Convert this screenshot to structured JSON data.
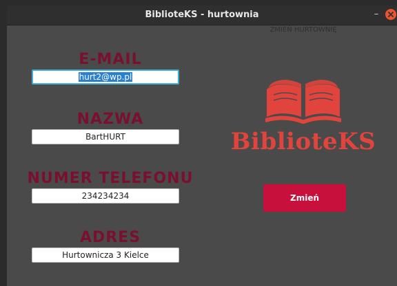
{
  "window": {
    "title": "BiblioteKS - hurtownia",
    "minimize_glyph": "–"
  },
  "form": {
    "email": {
      "label": "E-MAIL",
      "value": "hurt2@wp.pl"
    },
    "name": {
      "label": "NAZWA",
      "value": "BartHURT"
    },
    "phone": {
      "label": "NUMER TELEFONU",
      "value": "234234234"
    },
    "address": {
      "label": "ADRES",
      "value": "Hurtownicza 3 Kielce"
    }
  },
  "panel": {
    "heading": "ZMIEŃ HURTOWNIĘ",
    "logo_text": "BiblioteKS",
    "submit_label": "Zmień"
  },
  "colors": {
    "label": "#7a1030",
    "accent": "#c8103c",
    "logo": "#e0443c",
    "background": "#4a4a4a"
  },
  "icons": {
    "close": "close-icon",
    "minimize": "minimize-icon",
    "logo": "book-icon"
  }
}
